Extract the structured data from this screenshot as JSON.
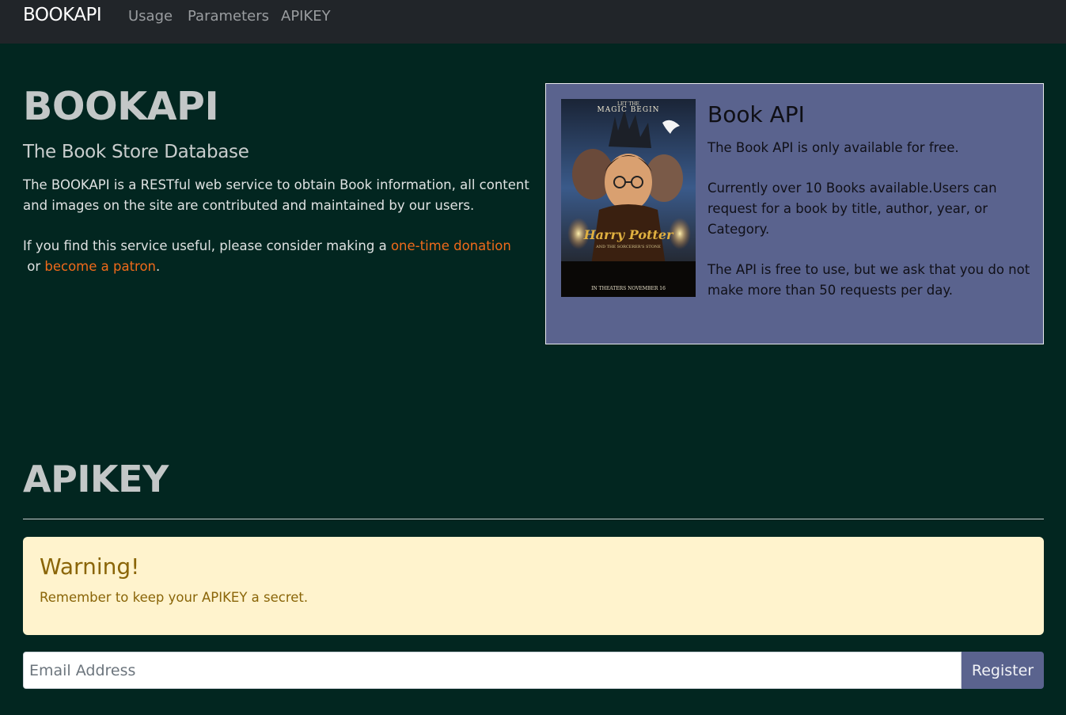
{
  "navbar": {
    "brand": "BOOKAPI",
    "links": [
      "Usage",
      "Parameters",
      "APIKEY"
    ]
  },
  "hero": {
    "title": "BOOKAPI",
    "subtitle": "The Book Store Database",
    "description": "The BOOKAPI is a RESTful web service to obtain Book information, all content and images on the site are contributed and maintained by our users.",
    "donate_prefix": "If you find this service useful, please consider making a ",
    "donate_link": "one-time donation",
    "donate_middle": " or ",
    "patron_link": "become a patron",
    "donate_suffix": "."
  },
  "card": {
    "title": "Book API",
    "paragraphs": [
      "The Book API is only available for free.",
      "Currently over 10 Books available.Users can request for a book by title, author, year, or Category.",
      "The API is free to use, but we ask that you do not make more than 50 requests per day."
    ],
    "poster": {
      "top_line": "LET THE",
      "headline": "MAGIC BEGIN",
      "logo": "Harry Potter",
      "logo_sub": "AND THE SORCERER'S STONE",
      "bottom_line": "IN THEATERS NOVEMBER 16"
    }
  },
  "apikey": {
    "title": "APIKEY",
    "warning_title": "Warning!",
    "warning_text": "Remember to keep your APIKEY a secret.",
    "email_placeholder": "Email Address",
    "register_label": "Register"
  },
  "colors": {
    "page_bg": "#022620",
    "navbar_bg": "#212529",
    "card_bg": "#5a638e",
    "link_orange": "#f06a1a",
    "alert_bg": "#fff3cd",
    "alert_text": "#8a6508"
  }
}
